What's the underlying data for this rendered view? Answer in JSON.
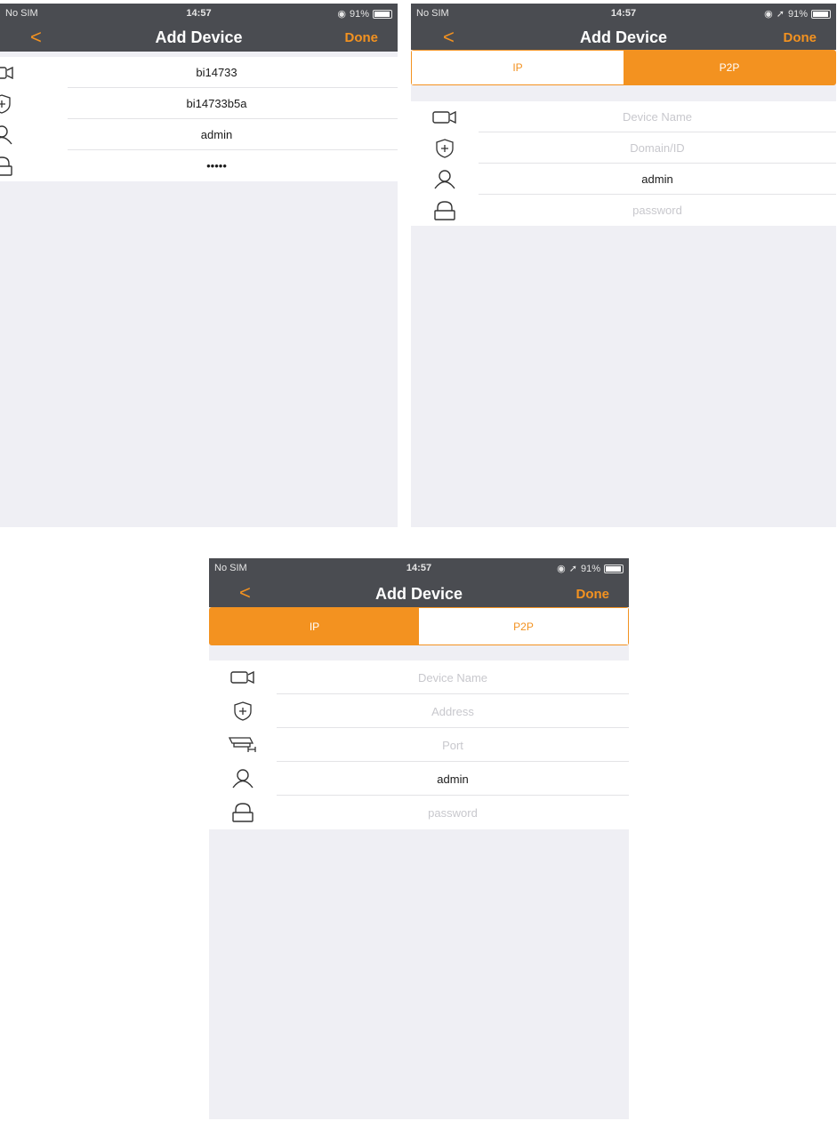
{
  "statusbar": {
    "carrier": "No SIM",
    "time": "14:57",
    "battery": "91%"
  },
  "navbar": {
    "back_glyph": "<",
    "title": "Add Device",
    "done_label": "Done"
  },
  "segment": {
    "ip_label": "IP",
    "p2p_label": "P2P"
  },
  "screenA": {
    "fields": {
      "device_name": "bi14733",
      "domain_id": "bi14733b5a",
      "username": "admin",
      "password": "•••••"
    }
  },
  "screenB": {
    "selected_tab": "P2P",
    "placeholders": {
      "device_name": "Device Name",
      "domain_id": "Domain/ID",
      "password": "password"
    },
    "username": "admin"
  },
  "screenC": {
    "selected_tab": "IP",
    "placeholders": {
      "device_name": "Device Name",
      "address": "Address",
      "port": "Port",
      "password": "password"
    },
    "username": "admin"
  },
  "colors": {
    "accent": "#f39220",
    "navbar": "#4a4c51",
    "background": "#efeff4"
  },
  "icons": [
    "camera-icon",
    "shield-plus-icon",
    "user-icon",
    "lock-icon",
    "cctv-icon"
  ]
}
